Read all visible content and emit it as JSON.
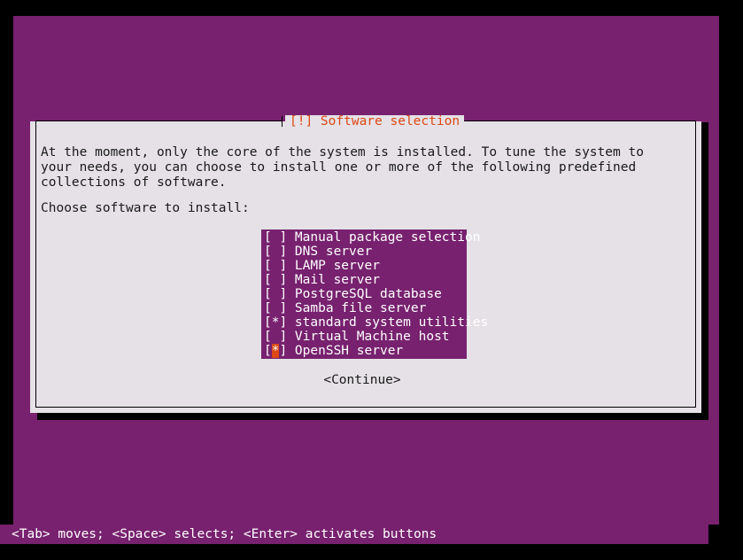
{
  "screen": {
    "background_color": "#77216F",
    "frame_color": "#000000"
  },
  "dialog": {
    "title": "[!] Software selection",
    "title_color": "#DD4814",
    "background_color": "#E5E1E6",
    "body_text": "At the moment, only the core of the system is installed. To tune the system to your needs, you can choose to install one or more of the following predefined collections of software.",
    "prompt": "Choose software to install:",
    "continue_label": "<Continue>"
  },
  "package_list": {
    "background_color": "#77216F",
    "cursor_color": "#DD4814",
    "items": [
      {
        "checkbox": "[ ]",
        "label": "Manual package selection",
        "checked": false,
        "cursor": false
      },
      {
        "checkbox": "[ ]",
        "label": "DNS server",
        "checked": false,
        "cursor": false
      },
      {
        "checkbox": "[ ]",
        "label": "LAMP server",
        "checked": false,
        "cursor": false
      },
      {
        "checkbox": "[ ]",
        "label": "Mail server",
        "checked": false,
        "cursor": false
      },
      {
        "checkbox": "[ ]",
        "label": "PostgreSQL database",
        "checked": false,
        "cursor": false
      },
      {
        "checkbox": "[ ]",
        "label": "Samba file server",
        "checked": false,
        "cursor": false
      },
      {
        "checkbox": "[*]",
        "label": "standard system utilities",
        "checked": true,
        "cursor": false
      },
      {
        "checkbox": "[ ]",
        "label": "Virtual Machine host",
        "checked": false,
        "cursor": false
      },
      {
        "checkbox": "[*]",
        "label": "OpenSSH server",
        "checked": true,
        "cursor": true
      }
    ]
  },
  "statusbar": {
    "text": "<Tab> moves; <Space> selects; <Enter> activates buttons"
  }
}
